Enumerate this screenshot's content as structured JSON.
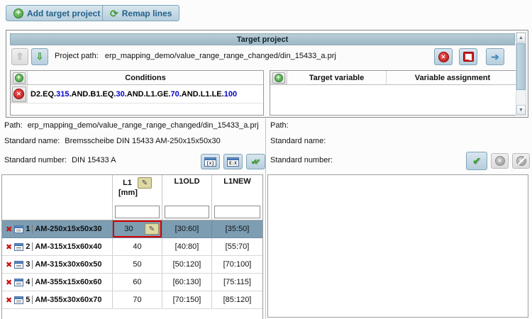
{
  "toolbar": {
    "add_label": "Add target project",
    "remap_label": "Remap lines"
  },
  "target_project": {
    "title": "Target project",
    "project_path_label": "Project path:",
    "project_path": "erp_mapping_demo/value_range_range_changed/din_15433_a.prj",
    "conditions": {
      "header": "Conditions",
      "rows": [
        {
          "segments": [
            {
              "text": "D2.EQ.",
              "color": "text"
            },
            {
              "text": "315",
              "color": "num"
            },
            {
              "text": ".AND.B1.EQ.",
              "color": "text"
            },
            {
              "text": "30",
              "color": "num"
            },
            {
              "text": ".AND.L1.GE.",
              "color": "text"
            },
            {
              "text": "70",
              "color": "num"
            },
            {
              "text": ".AND.L1.LE.",
              "color": "text"
            },
            {
              "text": "100",
              "color": "num"
            }
          ]
        }
      ]
    },
    "assignments": {
      "target_variable_header": "Target variable",
      "variable_assignment_header": "Variable assignment",
      "rows": []
    }
  },
  "source_info": {
    "path_label": "Path:",
    "path": "erp_mapping_demo/value_range_range_changed/din_15433_a.prj",
    "standard_name_label": "Standard name:",
    "standard_name": "Bremsscheibe DIN 15433 AM-250x15x50x30",
    "standard_number_label": "Standard number:",
    "standard_number": "DIN 15433 A"
  },
  "target_info": {
    "path_label": "Path:",
    "path": "",
    "standard_name_label": "Standard name:",
    "standard_name": "",
    "standard_number_label": "Standard number:",
    "standard_number": ""
  },
  "results": {
    "columns": [
      {
        "name": "L1",
        "unit": "[mm]"
      },
      {
        "name": "L1OLD"
      },
      {
        "name": "L1NEW"
      }
    ],
    "rows": [
      {
        "index": "1",
        "label": "AM-250x15x50x30",
        "l1": "30",
        "l1old": "[30:60]",
        "l1new": "[35:50]",
        "selected": true,
        "highlighted": true
      },
      {
        "index": "2",
        "label": "AM-315x15x60x40",
        "l1": "40",
        "l1old": "[40:80]",
        "l1new": "[55:70]",
        "selected": false,
        "highlighted": false
      },
      {
        "index": "3",
        "label": "AM-315x30x60x50",
        "l1": "50",
        "l1old": "[50:120]",
        "l1new": "[70:100]",
        "selected": false,
        "highlighted": false
      },
      {
        "index": "4",
        "label": "AM-355x15x60x60",
        "l1": "60",
        "l1old": "[60:130]",
        "l1new": "[75:115]",
        "selected": false,
        "highlighted": false
      },
      {
        "index": "5",
        "label": "AM-355x30x60x70",
        "l1": "70",
        "l1old": "[70:150]",
        "l1new": "[85:120]",
        "selected": false,
        "highlighted": false
      }
    ]
  },
  "icons": {
    "add_plus": "+",
    "remap_recycle": "⟳",
    "up_arrow": "⇧",
    "down_arrow": "⇩",
    "circle_x": "✕",
    "forward_arrow": "➜",
    "row_delete": "✖",
    "pencil": "✎",
    "check": "✔",
    "double_check": "✔✔",
    "var_window_text": "[x]",
    "expr_window_text": "E:X",
    "scroll_up": "▲",
    "scroll_down": "▼"
  },
  "colors": {
    "accent_header": "#a9c2ce",
    "selected_row": "#7c9db2",
    "highlight_border": "#d40000",
    "condition_number": "#0000cd",
    "condition_text": "#000000",
    "button_text": "#24628b",
    "green_icon": "#3f9c35",
    "red_icon": "#c62121"
  }
}
